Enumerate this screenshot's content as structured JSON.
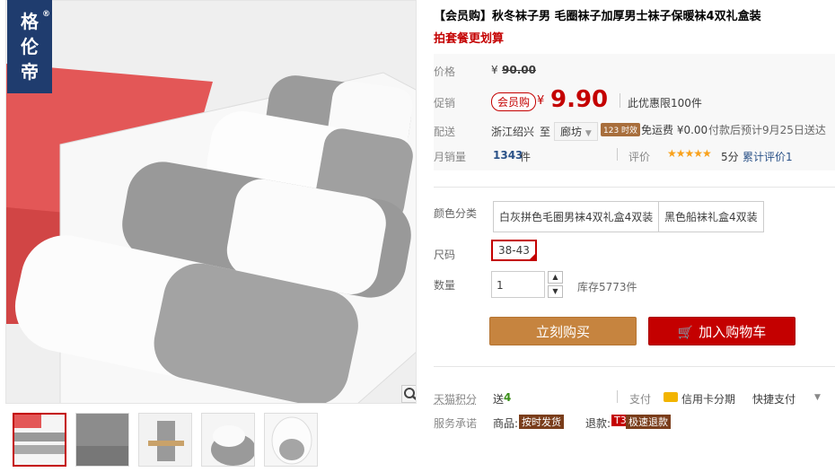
{
  "brand": {
    "logo_text": [
      "格",
      "伦",
      "帝"
    ],
    "registered": "®"
  },
  "title": "【会员购】秋冬袜子男 毛圈袜子加厚男士袜子保暖袜4双礼盒装",
  "subtitle": "拍套餐更划算",
  "price": {
    "label": "价格",
    "currency": "¥",
    "original": "90.00"
  },
  "promo": {
    "label": "促销",
    "member_tag": "会员购",
    "currency": "¥",
    "price": "9.90",
    "limit": "此优惠限100件"
  },
  "shipping": {
    "label": "配送",
    "from": "浙江绍兴",
    "to_word": "至",
    "city": "廊坊",
    "speed_badge": "123 时效",
    "fee": "免运费 ¥0.00",
    "eta": "付款后预计9月25日送达"
  },
  "sales": {
    "label": "月销量",
    "count": "1343",
    "unit": "件",
    "review_label": "评价",
    "stars": "★★★★★",
    "score": "5分",
    "review_count": "累计评价1"
  },
  "color": {
    "label": "颜色分类",
    "options": [
      "白灰拼色毛圈男袜4双礼盒4双装",
      "黑色船袜礼盒4双装"
    ]
  },
  "size": {
    "label": "尺码",
    "selected": "38-43"
  },
  "quantity": {
    "label": "数量",
    "value": "1",
    "stock": "库存5773件",
    "up": "▲",
    "down": "▼"
  },
  "actions": {
    "buy_now": "立刻购买",
    "add_cart": "加入购物车",
    "cart_icon": "🛒"
  },
  "points": {
    "label": "天猫积分",
    "text": "送",
    "value": "4"
  },
  "payment": {
    "label": "支付",
    "credit": "信用卡分期",
    "quick": "快捷支付"
  },
  "service": {
    "label": "服务承诺",
    "goods_label": "商品:",
    "goods_tag": "按时发货",
    "refund_label": "退款:",
    "refund_tag_prefix": "T3",
    "refund_tag": "极速退款"
  },
  "colors": {
    "accent": "#c40000",
    "buy": "#c6843f",
    "logo_bg": "#1f3c6e"
  },
  "icons": {
    "zoom": "magnifier-icon",
    "cart": "cart-icon",
    "card": "credit-card-icon"
  }
}
